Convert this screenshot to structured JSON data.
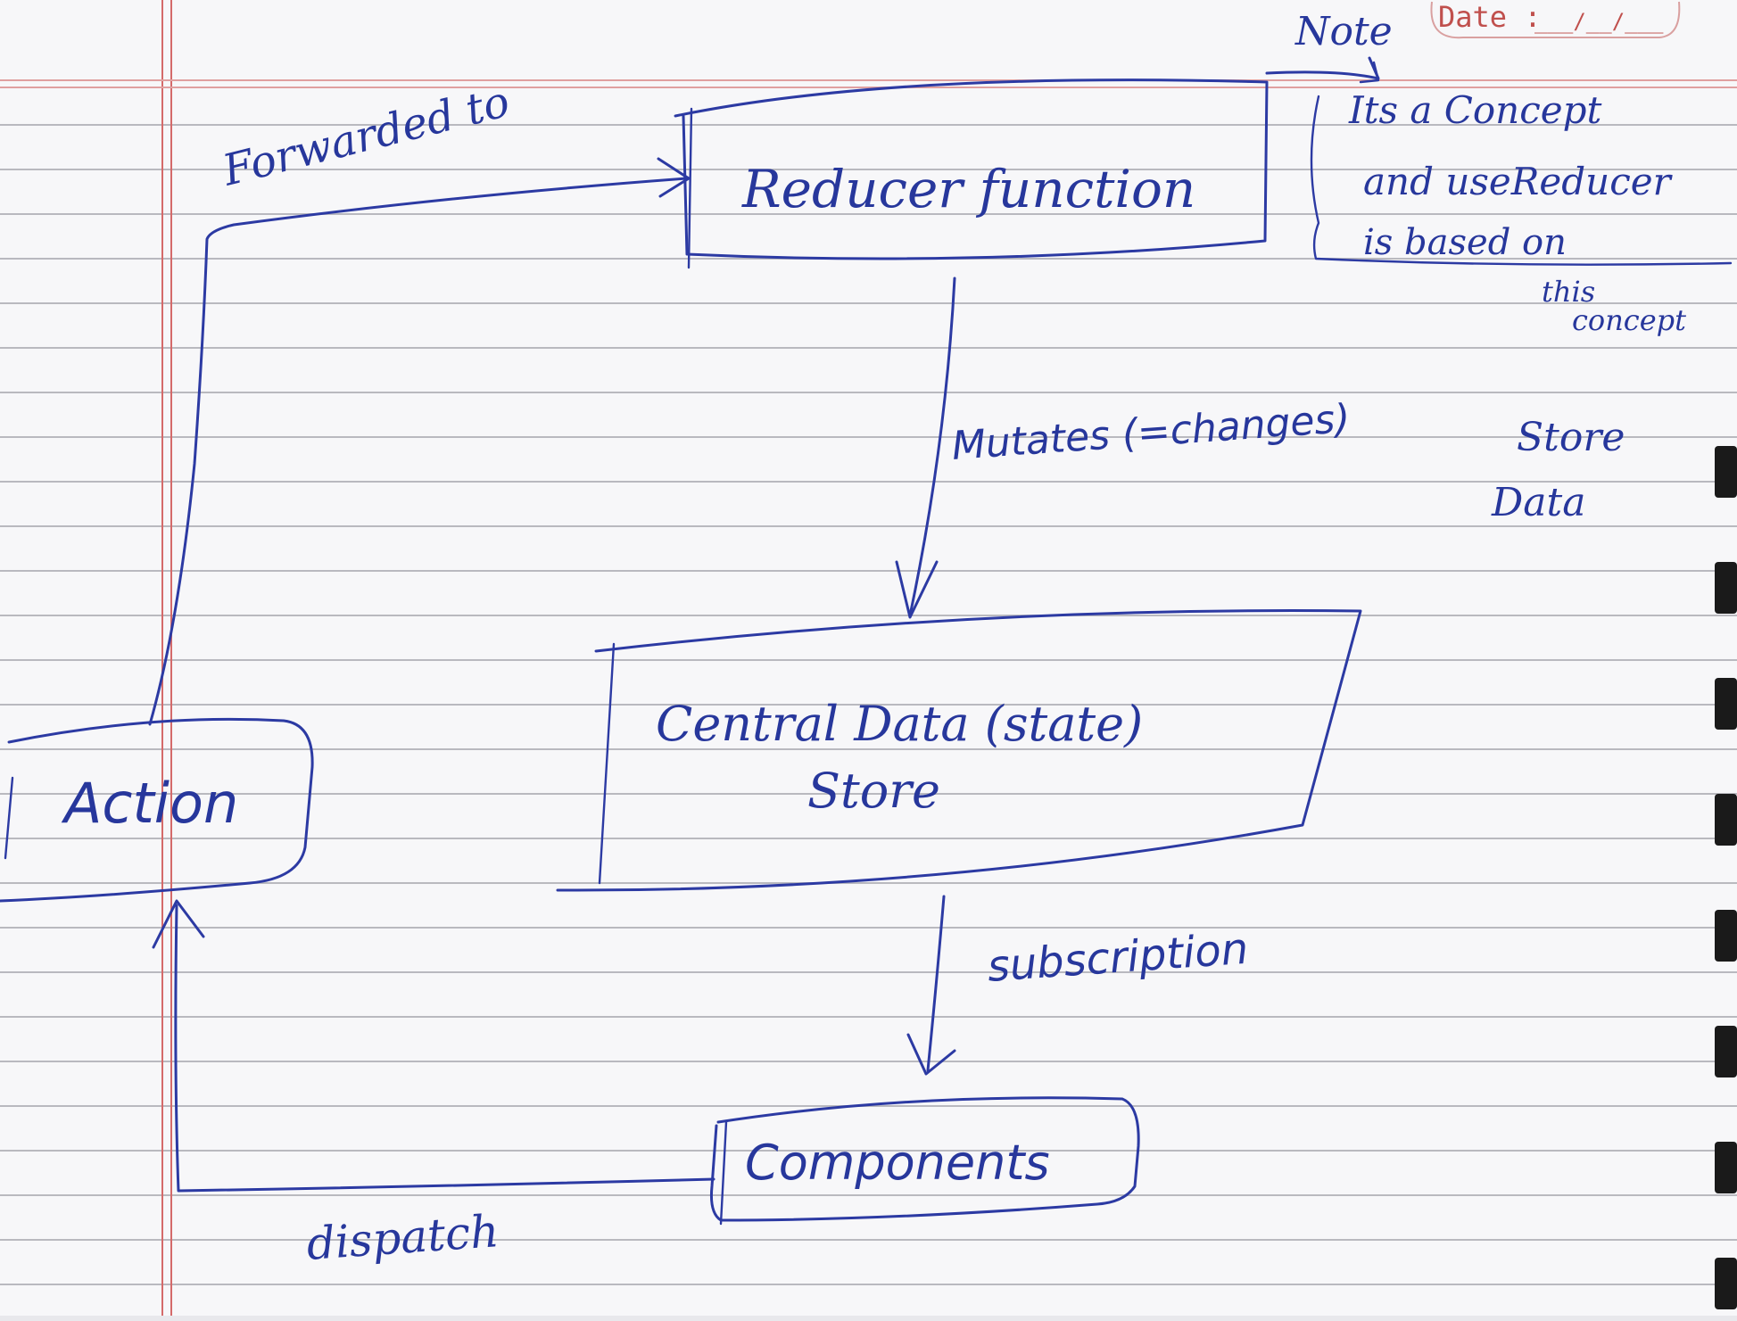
{
  "header": {
    "date_label": "Date :",
    "date_blank": "___/__/___"
  },
  "diagram": {
    "nodes": {
      "reducer": "Reducer function",
      "store_line1": "Central Data (state)",
      "store_line2": "Store",
      "action": "Action",
      "components": "Components"
    },
    "edges": {
      "forwarded": "Forwarded to",
      "mutates": "Mutates (=changes)",
      "store_data_line1": "Store",
      "store_data_line2": "Data",
      "subscription": "subscription",
      "dispatch": "dispatch"
    },
    "note": {
      "label": "Note",
      "line1": "Its a Concept",
      "line2": "and useReducer",
      "line3": "is based on",
      "line4": "this",
      "line5": "concept"
    }
  },
  "colors": {
    "ink": "#2c3aa3",
    "rule": "#b9b9bf",
    "margin": "#d46a6a",
    "header_red": "#c0504d"
  }
}
